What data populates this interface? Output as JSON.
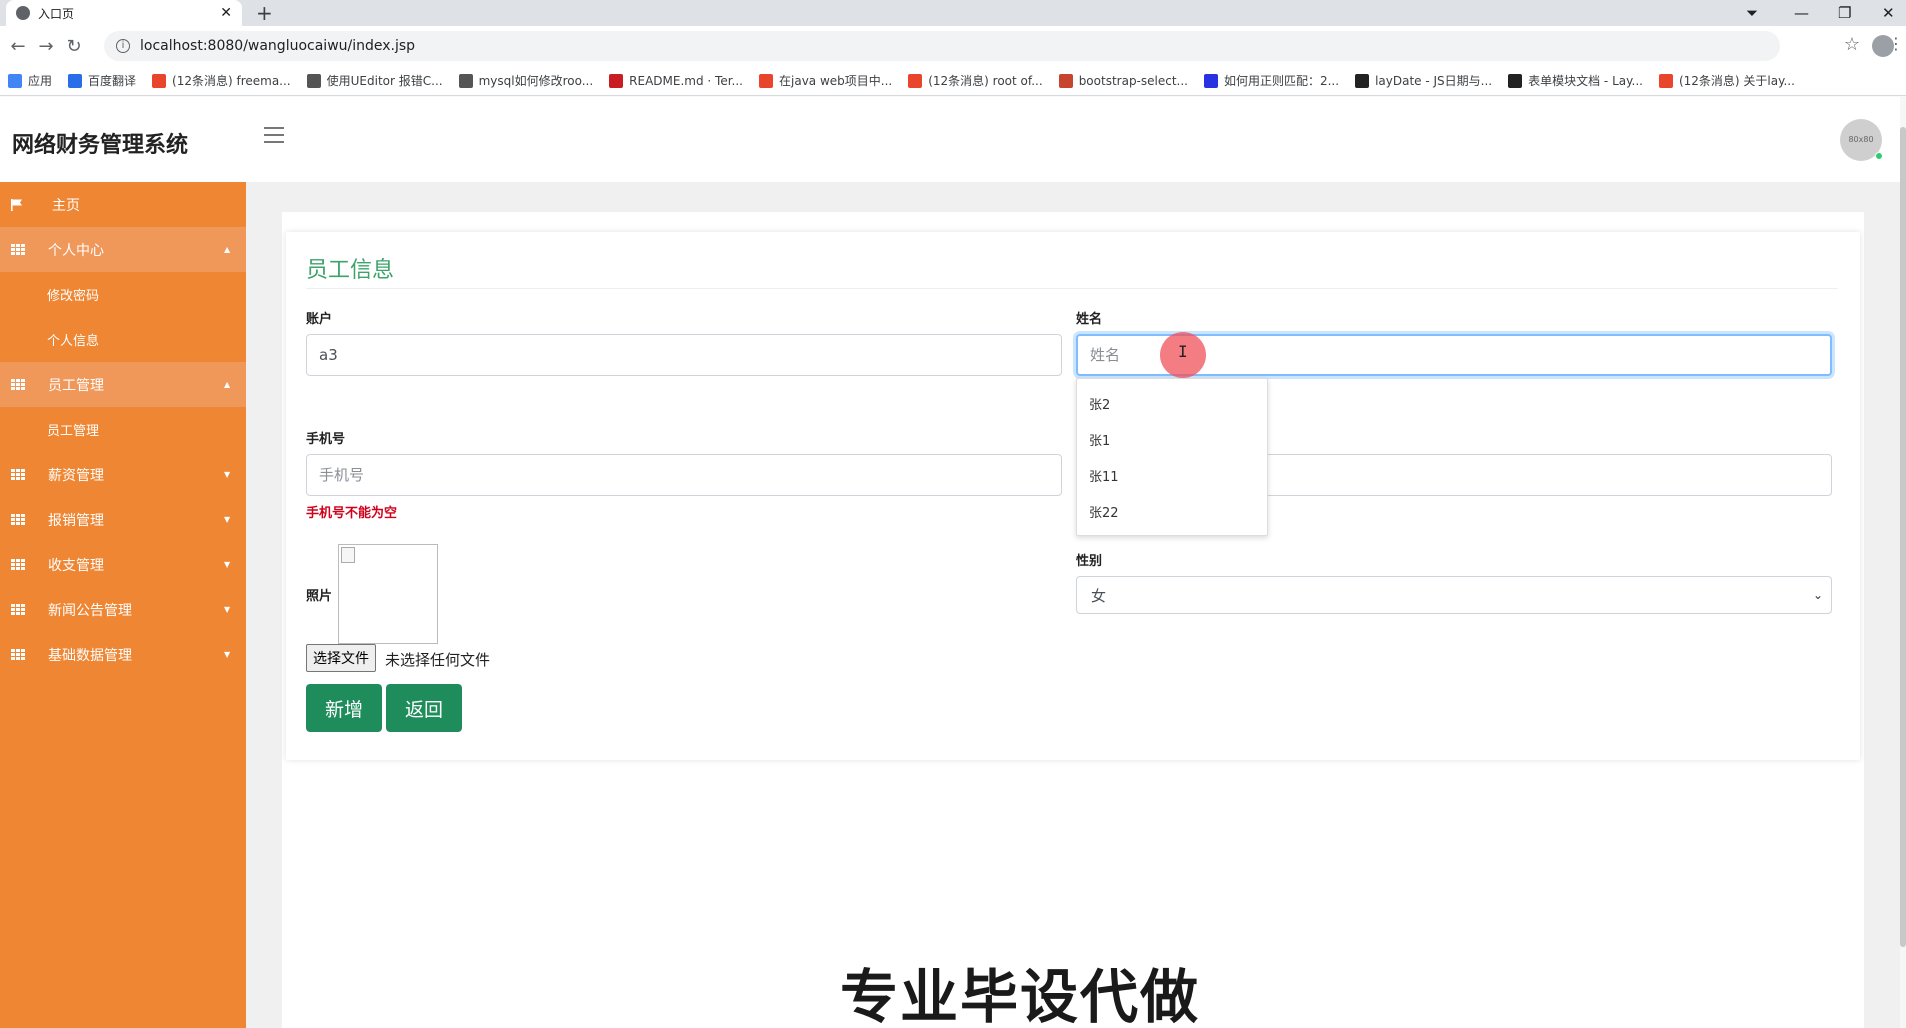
{
  "browser": {
    "tab_title": "入口页",
    "url": "localhost:8080/wangluocaiwu/index.jsp",
    "bookmarks": [
      {
        "label": "应用",
        "color": "#4285f4"
      },
      {
        "label": "百度翻译",
        "color": "#2a6de8"
      },
      {
        "label": "(12条消息) freema...",
        "color": "#e8452c"
      },
      {
        "label": "使用UEditor 报错C...",
        "color": "#555555"
      },
      {
        "label": "mysql如何修改roo...",
        "color": "#555555"
      },
      {
        "label": "README.md · Ter...",
        "color": "#c71d23"
      },
      {
        "label": "在java web项目中...",
        "color": "#e8452c"
      },
      {
        "label": "(12条消息) root of...",
        "color": "#e8452c"
      },
      {
        "label": "bootstrap-select...",
        "color": "#c7442f"
      },
      {
        "label": "如何用正则匹配：2...",
        "color": "#2932e1"
      },
      {
        "label": "layDate - JS日期与...",
        "color": "#222222"
      },
      {
        "label": "表单模块文档 - Lay...",
        "color": "#222222"
      },
      {
        "label": "(12条消息) 关于lay...",
        "color": "#e8452c"
      }
    ]
  },
  "header": {
    "brand": "网络财务管理系统",
    "avatar_text": "80x80"
  },
  "sidebar": {
    "items": [
      {
        "label": "主页",
        "icon": "flag-icon",
        "expanded": false
      },
      {
        "label": "个人中心",
        "icon": "grid-icon",
        "expanded": true,
        "children": [
          "修改密码",
          "个人信息"
        ]
      },
      {
        "label": "员工管理",
        "icon": "grid-icon",
        "expanded": true,
        "children": [
          "员工管理"
        ]
      },
      {
        "label": "薪资管理",
        "icon": "grid-icon",
        "expanded": false
      },
      {
        "label": "报销管理",
        "icon": "grid-icon",
        "expanded": false
      },
      {
        "label": "收支管理",
        "icon": "grid-icon",
        "expanded": false
      },
      {
        "label": "新闻公告管理",
        "icon": "grid-icon",
        "expanded": false
      },
      {
        "label": "基础数据管理",
        "icon": "grid-icon",
        "expanded": false
      }
    ]
  },
  "form": {
    "title": "员工信息",
    "account": {
      "label": "账户",
      "value": "a3"
    },
    "name": {
      "label": "姓名",
      "placeholder": "姓名",
      "value": ""
    },
    "phone": {
      "label": "手机号",
      "placeholder": "手机号",
      "error": "手机号不能为空"
    },
    "photo": {
      "label": "照片",
      "file_button": "选择文件",
      "file_status": "未选择任何文件"
    },
    "gender": {
      "label": "性别",
      "selected": "女"
    },
    "buttons": {
      "add": "新增",
      "back": "返回"
    }
  },
  "autocomplete": {
    "options": [
      "张2",
      "张1",
      "张11",
      "张22"
    ]
  },
  "watermark": "专业毕设代做",
  "colors": {
    "sidebar": "#ee8633",
    "sidebar_open": "#f0975a",
    "title_green": "#3ea36b",
    "button_green": "#1f8c5c",
    "error_red": "#d0021b"
  }
}
